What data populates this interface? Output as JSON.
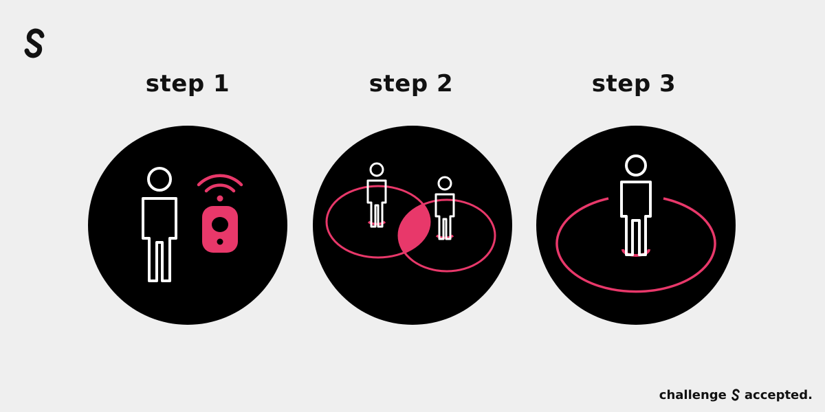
{
  "colors": {
    "background": "#efefef",
    "circle": "#000000",
    "accent": "#e8386a",
    "figure": "#ffffff",
    "text": "#111111"
  },
  "logo": {
    "icon": "s-link-logo-icon"
  },
  "steps": [
    {
      "label": "step 1",
      "icon": "person-with-wireless-beacon-icon"
    },
    {
      "label": "step 2",
      "icon": "two-people-overlapping-zones-icon"
    },
    {
      "label": "step 3",
      "icon": "person-in-single-zone-icon"
    }
  ],
  "tagline": {
    "before": "challenge",
    "after": "accepted."
  }
}
